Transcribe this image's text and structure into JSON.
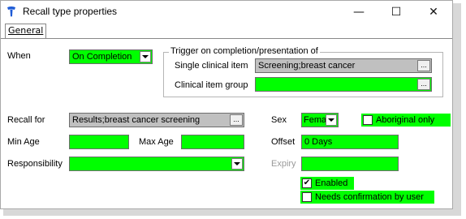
{
  "window": {
    "title": "Recall type properties",
    "minimize_glyph": "—",
    "maximize_glyph": "☐",
    "close_glyph": "✕"
  },
  "tabs": [
    {
      "label": "General",
      "selected": true
    }
  ],
  "form": {
    "when": {
      "label": "When",
      "value": "On Completion"
    },
    "trigger_group": {
      "label": "Trigger on completion/presentation of",
      "single_item": {
        "label": "Single clinical item",
        "value": "Screening;breast cancer"
      },
      "item_group": {
        "label": "Clinical item group",
        "value": ""
      },
      "ellipsis": "..."
    },
    "recall_for": {
      "label": "Recall for",
      "value": "Results;breast cancer screening",
      "ellipsis": "..."
    },
    "sex": {
      "label": "Sex",
      "value": "Fema"
    },
    "aboriginal_only": {
      "label": "Aboriginal only",
      "checked": false
    },
    "min_age": {
      "label": "Min Age",
      "value": ""
    },
    "max_age": {
      "label": "Max Age",
      "value": ""
    },
    "offset": {
      "label": "Offset",
      "value": "0 Days"
    },
    "responsibility": {
      "label": "Responsibility",
      "value": ""
    },
    "expiry": {
      "label": "Expiry",
      "value": "",
      "disabled": true
    },
    "enabled": {
      "label": "Enabled",
      "checked": true,
      "check_glyph": "✔"
    },
    "needs_confirmation": {
      "label": "Needs confirmation by user",
      "checked": false
    }
  },
  "colors": {
    "required_field": "#00ff00",
    "readonly_field": "#c0c0c0",
    "disabled_text": "#9a9a9a"
  }
}
